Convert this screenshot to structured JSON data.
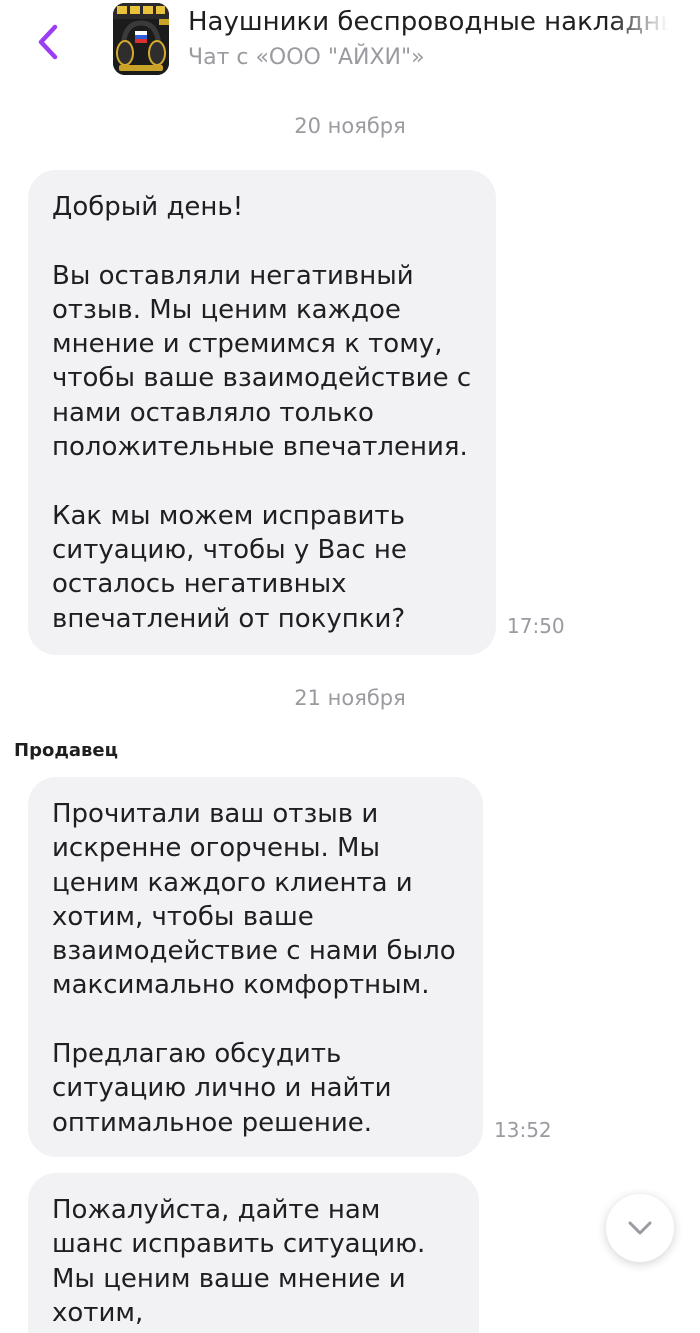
{
  "header": {
    "title": "Наушники беспроводные накладные",
    "subtitle": "Чат с «ООО \"АЙХИ\"»"
  },
  "thread": {
    "date_1": "20 ноября",
    "message_1": {
      "text": "Добрый день!\n\nВы оставляли негативный отзыв. Мы ценим каждое мнение и стремимся к тому, чтобы ваше взаимодействие с нами оставляло только положительные впечатления.\n\nКак мы можем исправить ситуацию, чтобы у Вас не осталось негативных впечатлений от покупки?",
      "time": "17:50"
    },
    "date_2": "21 ноября",
    "sender_label": "Продавец",
    "message_2": {
      "text": "Прочитали ваш отзыв и искренне огорчены. Мы ценим каждого клиента и хотим, чтобы ваше взаимодействие с нами было максимально комфортным.\n\nПредлагаю обсудить ситуацию лично и найти оптимальное решение.",
      "time": "13:52"
    },
    "message_3": {
      "text": "Пожалуйста, дайте нам шанс исправить ситуацию. Мы ценим ваше мнение и хотим,"
    }
  },
  "colors": {
    "accent": "#9b3df2",
    "bubble_bg": "#f2f2f5",
    "muted_text": "#9a9aa0"
  },
  "icons": {
    "back": "chevron-left-icon",
    "scroll_down": "chevron-down-icon"
  }
}
